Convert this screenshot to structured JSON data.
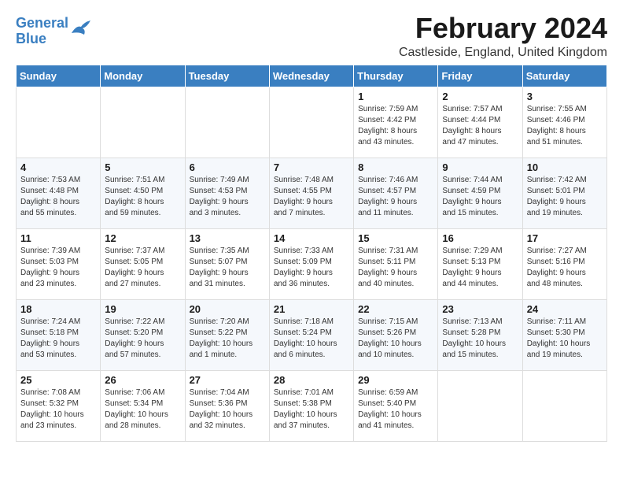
{
  "logo": {
    "line1": "General",
    "line2": "Blue"
  },
  "title": "February 2024",
  "subtitle": "Castleside, England, United Kingdom",
  "days_of_week": [
    "Sunday",
    "Monday",
    "Tuesday",
    "Wednesday",
    "Thursday",
    "Friday",
    "Saturday"
  ],
  "weeks": [
    [
      {
        "day": "",
        "info": ""
      },
      {
        "day": "",
        "info": ""
      },
      {
        "day": "",
        "info": ""
      },
      {
        "day": "",
        "info": ""
      },
      {
        "day": "1",
        "info": "Sunrise: 7:59 AM\nSunset: 4:42 PM\nDaylight: 8 hours\nand 43 minutes."
      },
      {
        "day": "2",
        "info": "Sunrise: 7:57 AM\nSunset: 4:44 PM\nDaylight: 8 hours\nand 47 minutes."
      },
      {
        "day": "3",
        "info": "Sunrise: 7:55 AM\nSunset: 4:46 PM\nDaylight: 8 hours\nand 51 minutes."
      }
    ],
    [
      {
        "day": "4",
        "info": "Sunrise: 7:53 AM\nSunset: 4:48 PM\nDaylight: 8 hours\nand 55 minutes."
      },
      {
        "day": "5",
        "info": "Sunrise: 7:51 AM\nSunset: 4:50 PM\nDaylight: 8 hours\nand 59 minutes."
      },
      {
        "day": "6",
        "info": "Sunrise: 7:49 AM\nSunset: 4:53 PM\nDaylight: 9 hours\nand 3 minutes."
      },
      {
        "day": "7",
        "info": "Sunrise: 7:48 AM\nSunset: 4:55 PM\nDaylight: 9 hours\nand 7 minutes."
      },
      {
        "day": "8",
        "info": "Sunrise: 7:46 AM\nSunset: 4:57 PM\nDaylight: 9 hours\nand 11 minutes."
      },
      {
        "day": "9",
        "info": "Sunrise: 7:44 AM\nSunset: 4:59 PM\nDaylight: 9 hours\nand 15 minutes."
      },
      {
        "day": "10",
        "info": "Sunrise: 7:42 AM\nSunset: 5:01 PM\nDaylight: 9 hours\nand 19 minutes."
      }
    ],
    [
      {
        "day": "11",
        "info": "Sunrise: 7:39 AM\nSunset: 5:03 PM\nDaylight: 9 hours\nand 23 minutes."
      },
      {
        "day": "12",
        "info": "Sunrise: 7:37 AM\nSunset: 5:05 PM\nDaylight: 9 hours\nand 27 minutes."
      },
      {
        "day": "13",
        "info": "Sunrise: 7:35 AM\nSunset: 5:07 PM\nDaylight: 9 hours\nand 31 minutes."
      },
      {
        "day": "14",
        "info": "Sunrise: 7:33 AM\nSunset: 5:09 PM\nDaylight: 9 hours\nand 36 minutes."
      },
      {
        "day": "15",
        "info": "Sunrise: 7:31 AM\nSunset: 5:11 PM\nDaylight: 9 hours\nand 40 minutes."
      },
      {
        "day": "16",
        "info": "Sunrise: 7:29 AM\nSunset: 5:13 PM\nDaylight: 9 hours\nand 44 minutes."
      },
      {
        "day": "17",
        "info": "Sunrise: 7:27 AM\nSunset: 5:16 PM\nDaylight: 9 hours\nand 48 minutes."
      }
    ],
    [
      {
        "day": "18",
        "info": "Sunrise: 7:24 AM\nSunset: 5:18 PM\nDaylight: 9 hours\nand 53 minutes."
      },
      {
        "day": "19",
        "info": "Sunrise: 7:22 AM\nSunset: 5:20 PM\nDaylight: 9 hours\nand 57 minutes."
      },
      {
        "day": "20",
        "info": "Sunrise: 7:20 AM\nSunset: 5:22 PM\nDaylight: 10 hours\nand 1 minute."
      },
      {
        "day": "21",
        "info": "Sunrise: 7:18 AM\nSunset: 5:24 PM\nDaylight: 10 hours\nand 6 minutes."
      },
      {
        "day": "22",
        "info": "Sunrise: 7:15 AM\nSunset: 5:26 PM\nDaylight: 10 hours\nand 10 minutes."
      },
      {
        "day": "23",
        "info": "Sunrise: 7:13 AM\nSunset: 5:28 PM\nDaylight: 10 hours\nand 15 minutes."
      },
      {
        "day": "24",
        "info": "Sunrise: 7:11 AM\nSunset: 5:30 PM\nDaylight: 10 hours\nand 19 minutes."
      }
    ],
    [
      {
        "day": "25",
        "info": "Sunrise: 7:08 AM\nSunset: 5:32 PM\nDaylight: 10 hours\nand 23 minutes."
      },
      {
        "day": "26",
        "info": "Sunrise: 7:06 AM\nSunset: 5:34 PM\nDaylight: 10 hours\nand 28 minutes."
      },
      {
        "day": "27",
        "info": "Sunrise: 7:04 AM\nSunset: 5:36 PM\nDaylight: 10 hours\nand 32 minutes."
      },
      {
        "day": "28",
        "info": "Sunrise: 7:01 AM\nSunset: 5:38 PM\nDaylight: 10 hours\nand 37 minutes."
      },
      {
        "day": "29",
        "info": "Sunrise: 6:59 AM\nSunset: 5:40 PM\nDaylight: 10 hours\nand 41 minutes."
      },
      {
        "day": "",
        "info": ""
      },
      {
        "day": "",
        "info": ""
      }
    ]
  ]
}
